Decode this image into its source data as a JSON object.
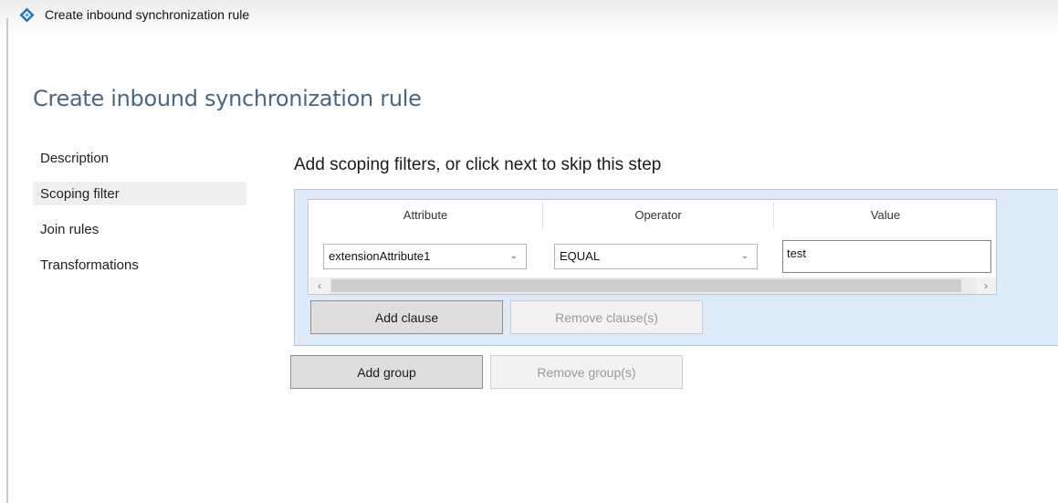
{
  "window": {
    "title": "Create inbound synchronization rule",
    "icon": "sync-rule-diamond-icon"
  },
  "page": {
    "heading": "Create inbound synchronization rule",
    "step_heading": "Add scoping filters, or click next to skip this step"
  },
  "nav": {
    "items": [
      {
        "label": "Description",
        "selected": false
      },
      {
        "label": "Scoping filter",
        "selected": true
      },
      {
        "label": "Join rules",
        "selected": false
      },
      {
        "label": "Transformations",
        "selected": false
      }
    ]
  },
  "scoping_group": {
    "columns": [
      "Attribute",
      "Operator",
      "Value"
    ],
    "clause": {
      "attribute": "extensionAttribute1",
      "operator": "EQUAL",
      "value": "test"
    },
    "add_clause_label": "Add clause",
    "remove_clause_label": "Remove clause(s)"
  },
  "group_actions": {
    "add_group_label": "Add group",
    "remove_group_label": "Remove group(s)"
  },
  "colors": {
    "heading": "#4a6782",
    "group_background": "#dcebf7",
    "icon_blue": "#1a78c2"
  }
}
